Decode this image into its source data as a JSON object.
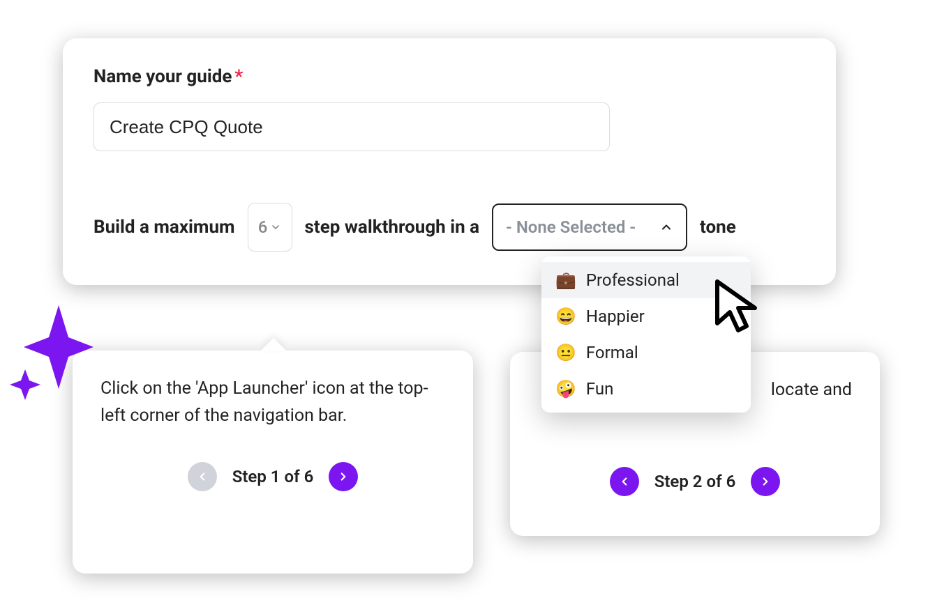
{
  "form": {
    "name_label": "Name your guide",
    "name_required_marker": "*",
    "name_value": "Create CPQ Quote",
    "sentence_part1": "Build a maximum",
    "step_count": "6",
    "sentence_part2": "step walkthrough in a",
    "tone_placeholder": "- None Selected -",
    "sentence_part3": "tone"
  },
  "tone_dropdown": {
    "options": [
      {
        "emoji": "💼",
        "label": "Professional",
        "selected": true
      },
      {
        "emoji": "😄",
        "label": "Happier",
        "selected": false
      },
      {
        "emoji": "😐",
        "label": "Formal",
        "selected": false
      },
      {
        "emoji": "🤪",
        "label": "Fun",
        "selected": false
      }
    ]
  },
  "tooltip1": {
    "text": "Click on the 'App Launcher' icon at the top-left corner of the navigation bar.",
    "step_label": "Step 1 of 6"
  },
  "tooltip2": {
    "text_visible_fragment": "locate and",
    "step_label": "Step 2 of 6"
  },
  "colors": {
    "accent": "#7b16f0",
    "disabled": "#d0d3d9"
  }
}
